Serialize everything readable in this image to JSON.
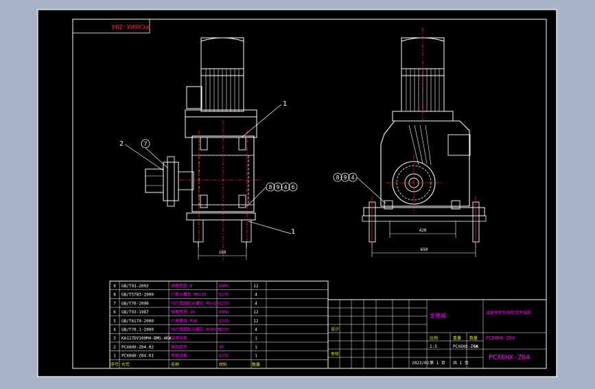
{
  "drawing": {
    "code_stamp": "PCX6HX-Z04",
    "title_code": "PCX6HX-Z04",
    "company": "金雅威",
    "product_title": "减速电机及链轮组件装配",
    "date": "2023/02",
    "scale": "1:5",
    "sheet": "第 1 页",
    "sheets_total": "共 1 页",
    "weight": "16",
    "drawing_no": "PCX6HX-Z04",
    "designer": "设计",
    "checker": "审核",
    "label_scale": "比例",
    "label_weight": "重量",
    "label_qty": "数量"
  },
  "callouts": {
    "front_top": "1",
    "front_left_num": "2",
    "front_circle": "7",
    "front_group": [
      "8",
      "9",
      "4",
      "6"
    ],
    "front_bottom": "1",
    "side_group": [
      "8",
      "9",
      "4"
    ]
  },
  "dimensions": {
    "front_width": "160",
    "side_inner": "420",
    "side_outer": "650"
  },
  "bom": [
    {
      "no": "9",
      "code": "GB/T93-2002",
      "name": "弹簧垫圈 8",
      "material": "65Mn",
      "qty": "12"
    },
    {
      "no": "8",
      "code": "GB/T5783-2000",
      "name": "六角头螺栓 M8×25",
      "material": "Q235",
      "qty": "4"
    },
    {
      "no": "7",
      "code": "GB/T70-2000",
      "name": "内六角圆柱头螺钉 M6×20",
      "material": "Q235",
      "qty": "4"
    },
    {
      "no": "6",
      "code": "GB/T93-1987",
      "name": "弹簧垫圈 10",
      "material": "65Mn",
      "qty": "12"
    },
    {
      "no": "5",
      "code": "GB/T6170-2000",
      "name": "六角螺母 M10",
      "material": "Q235",
      "qty": "12"
    },
    {
      "no": "4",
      "code": "GB/T70.1-2000",
      "name": "内六角圆柱头螺钉 M10×35",
      "material": "Q235",
      "qty": "4"
    },
    {
      "no": "3",
      "code": "KA127DV100M4-BMG-4KW",
      "name": "减速电机",
      "material": "",
      "qty": "1"
    },
    {
      "no": "2",
      "code": "PCX6HX-Z04.02",
      "name": "链轮组件",
      "material": "45",
      "qty": "1"
    },
    {
      "no": "1",
      "code": "PCX6HX-Z04.01",
      "name": "电机座板",
      "material": "Q235",
      "qty": "1"
    }
  ],
  "bom_header": {
    "no": "序号",
    "code": "代号",
    "name": "名称",
    "material": "材料",
    "qty": "数量"
  },
  "colors": {
    "background": "#a9b3c6",
    "sheet": "#000000",
    "line": "#ffffff",
    "red": "#ff0000",
    "blue": "#3355ff",
    "cyan": "#00c8c8",
    "yellow": "#e8e800",
    "magenta": "#ff00ff"
  }
}
